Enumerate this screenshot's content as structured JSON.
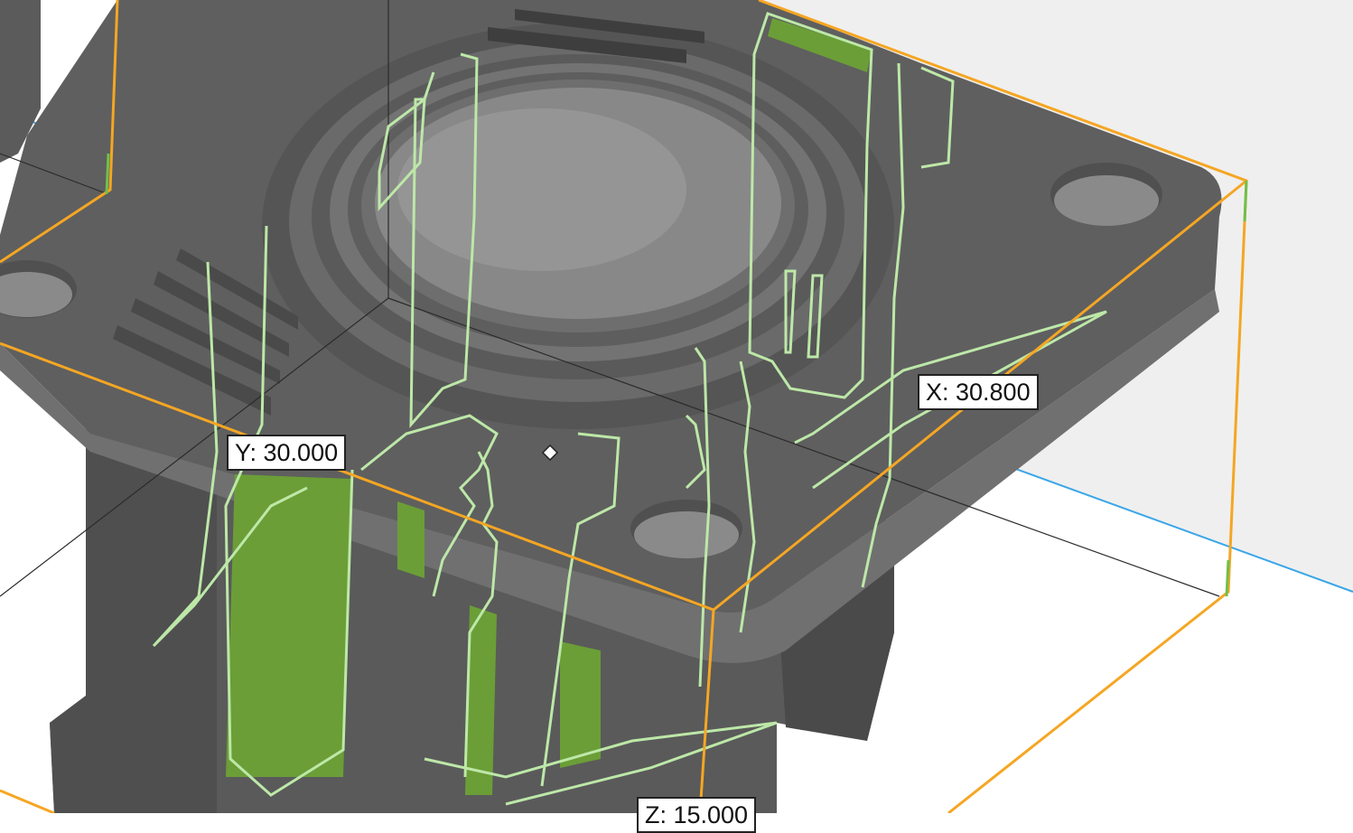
{
  "viewport": {
    "model": "part-model",
    "bounding_box_color": "#f5a623",
    "section_color": "#bde8a8",
    "section_fill_color": "#6b9e37",
    "body_color": "#636363",
    "background_color": "#f0f0f0",
    "ground_line_color": "#3aa6e8"
  },
  "dimensions": {
    "x_label": "X: 30.800",
    "y_label": "Y: 30.000",
    "z_label": "Z: 15.000"
  }
}
